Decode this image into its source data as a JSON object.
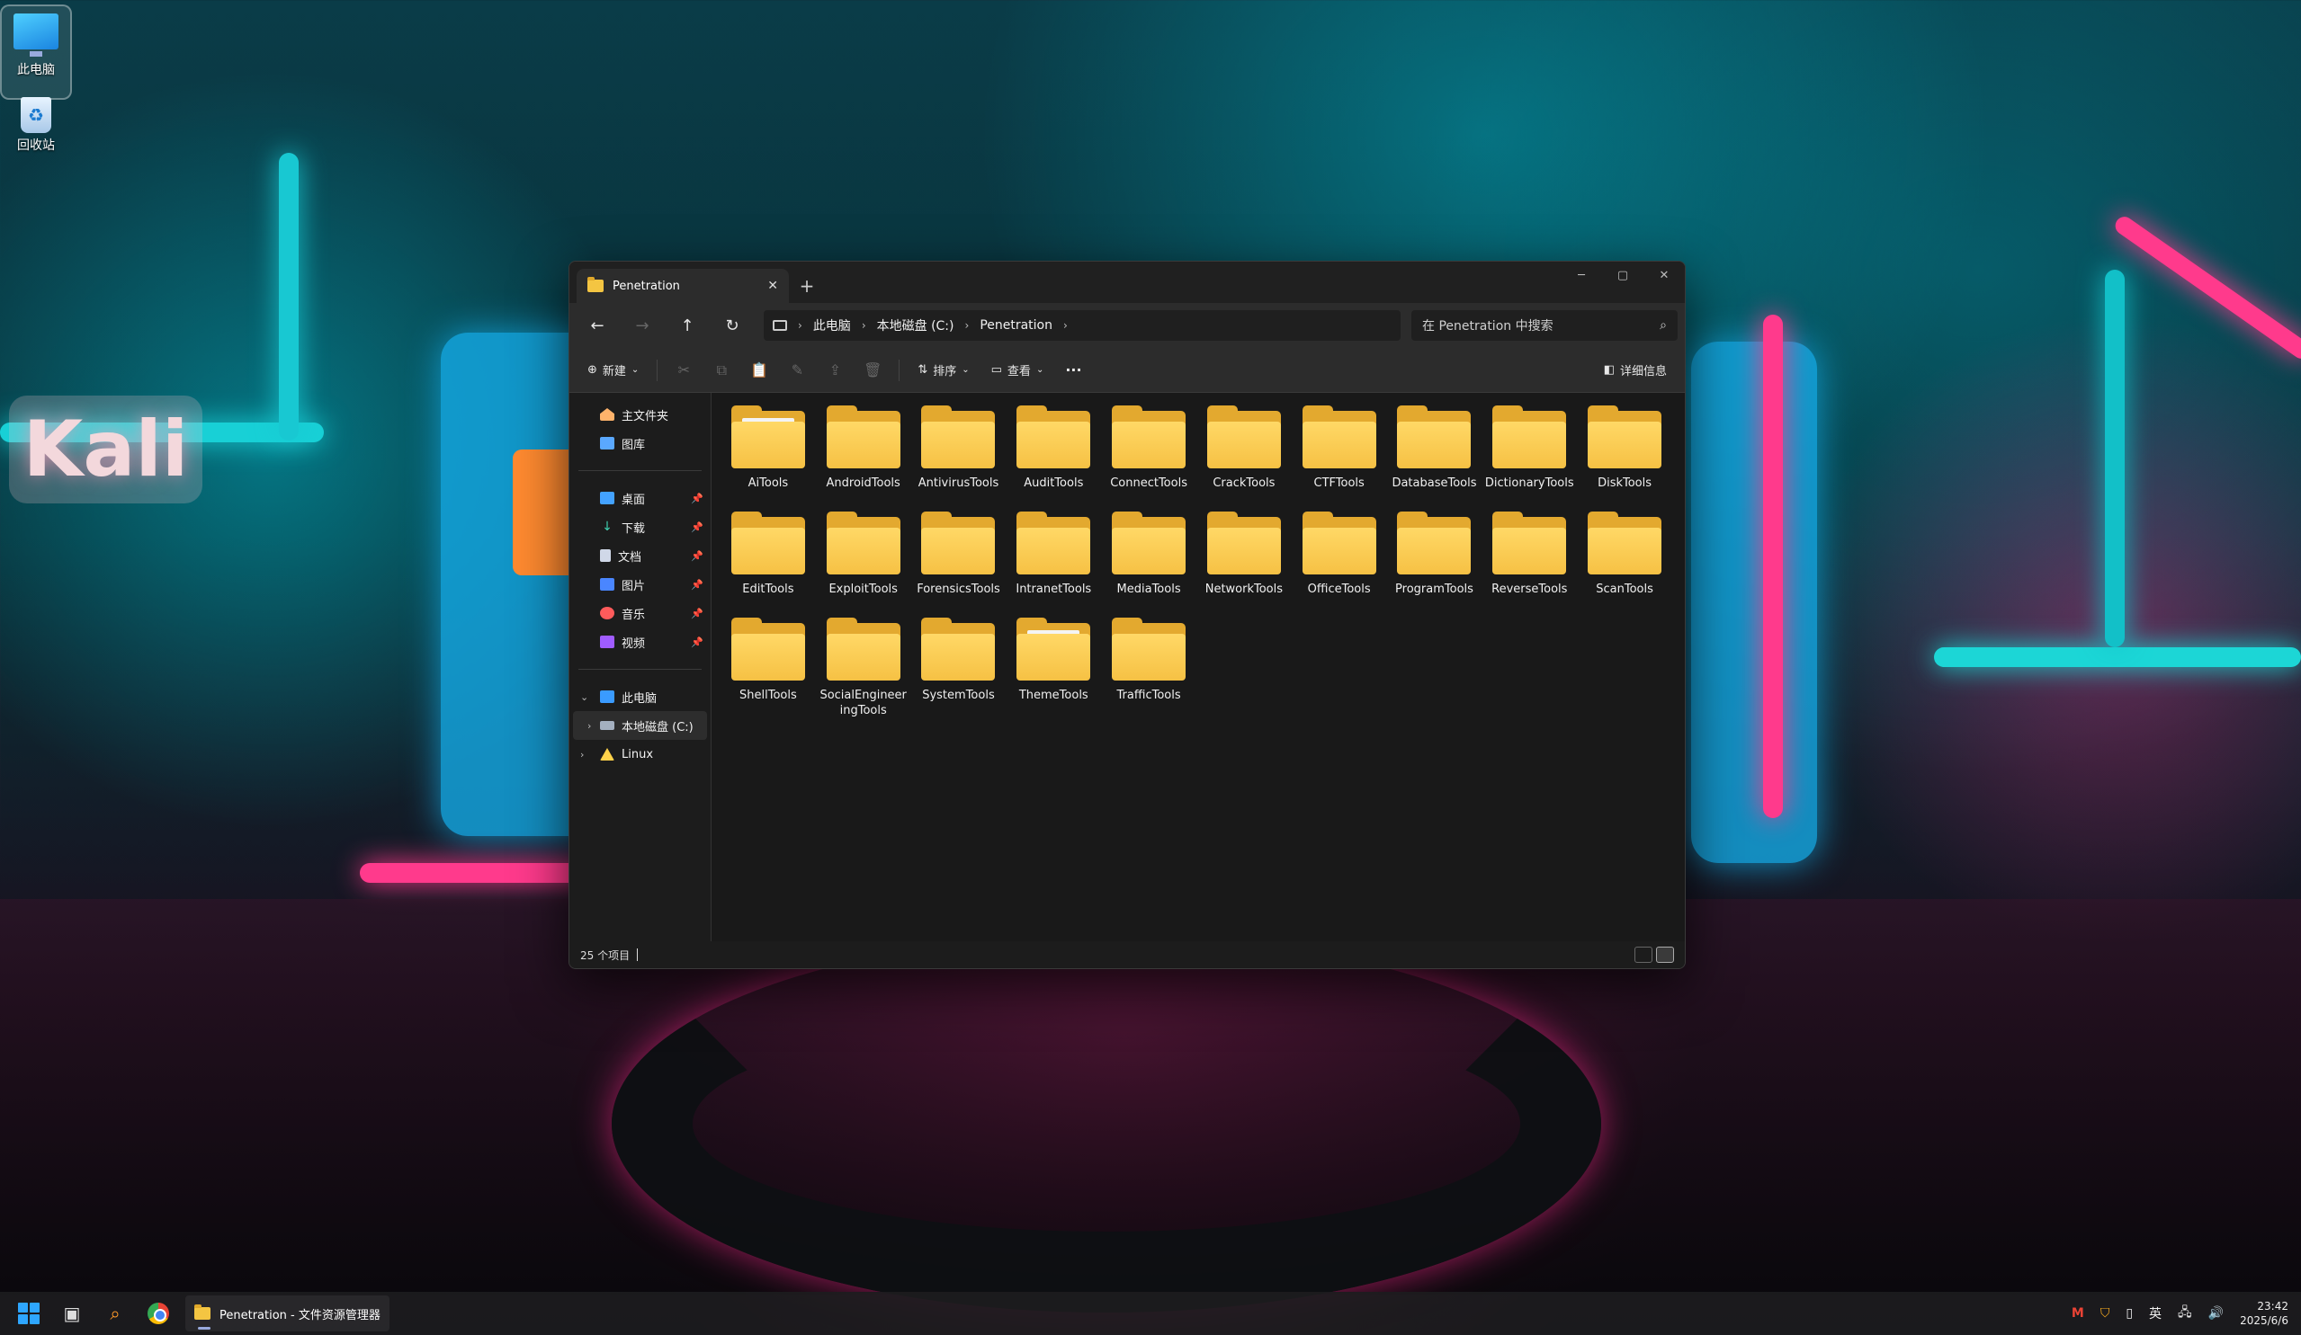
{
  "desktop": {
    "sign_text": "Kali",
    "icons": [
      {
        "label": "此电脑"
      },
      {
        "label": "回收站"
      }
    ]
  },
  "window": {
    "tab_title": "Penetration",
    "new_tab": "+",
    "address": {
      "segments": [
        "此电脑",
        "本地磁盘 (C:)",
        "Penetration"
      ]
    },
    "search_placeholder": "在 Penetration 中搜索",
    "toolbar": {
      "new_label": "新建",
      "sort_label": "排序",
      "view_label": "查看",
      "more_label": "···",
      "details_label": "详细信息"
    },
    "sidebar": {
      "top": [
        {
          "label": "主文件夹"
        },
        {
          "label": "图库"
        }
      ],
      "pinned": [
        {
          "label": "桌面"
        },
        {
          "label": "下载"
        },
        {
          "label": "文档"
        },
        {
          "label": "图片"
        },
        {
          "label": "音乐"
        },
        {
          "label": "视频"
        }
      ],
      "tree": [
        {
          "label": "此电脑"
        },
        {
          "label": "本地磁盘 (C:)"
        },
        {
          "label": "Linux"
        }
      ]
    },
    "folders": [
      "AiTools",
      "AndroidTools",
      "AntivirusTools",
      "AuditTools",
      "ConnectTools",
      "CrackTools",
      "CTFTools",
      "DatabaseTools",
      "DictionaryTools",
      "DiskTools",
      "EditTools",
      "ExploitTools",
      "ForensicsTools",
      "IntranetTools",
      "MediaTools",
      "NetworkTools",
      "OfficeTools",
      "ProgramTools",
      "ReverseTools",
      "ScanTools",
      "ShellTools",
      "SocialEngineeringTools",
      "SystemTools",
      "ThemeTools",
      "TrafficTools"
    ],
    "status": "25 个项目"
  },
  "taskbar": {
    "explorer_label": "Penetration - 文件资源管理器",
    "ime": "英",
    "time": "23:42",
    "date": "2025/6/6"
  },
  "colors": {
    "folder_front": "#ffd866",
    "folder_back": "#e3a92f",
    "accent": "#2ea6ff"
  }
}
